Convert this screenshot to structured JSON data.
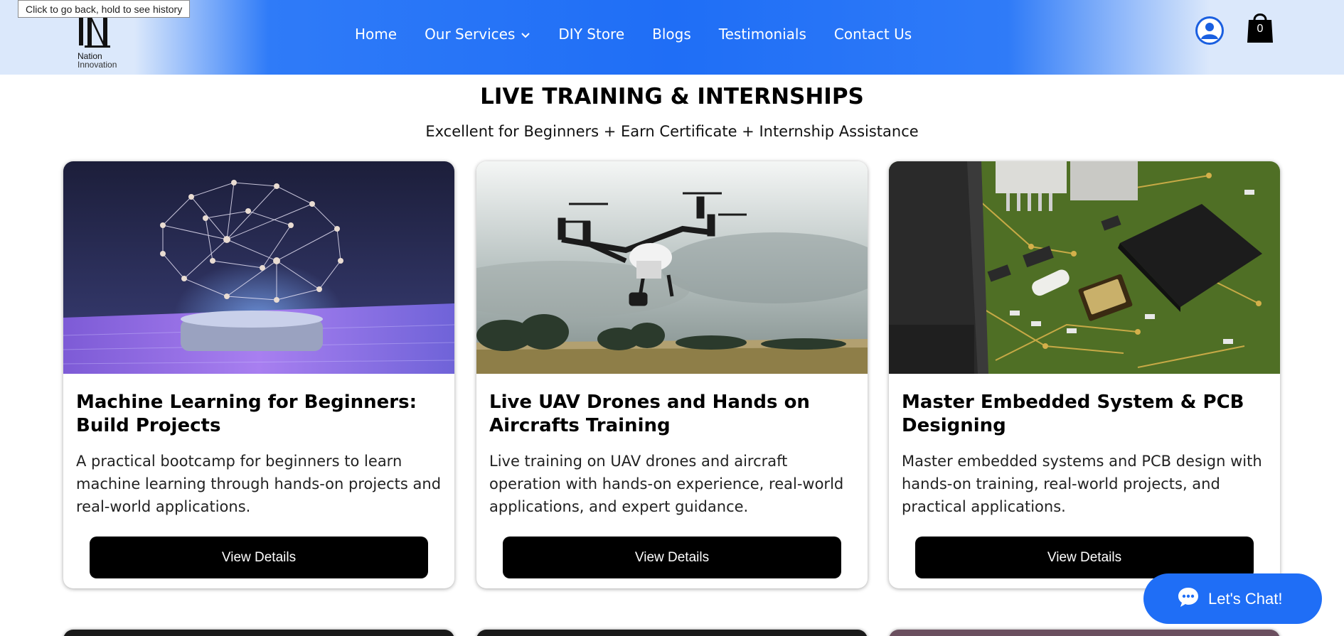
{
  "browser": {
    "back_tooltip": "Click to go back, hold to see history"
  },
  "header": {
    "logo_mark": "IN",
    "logo_line1": "Nation",
    "logo_line2": "Innovation",
    "nav": [
      {
        "label": "Home"
      },
      {
        "label": "Our Services"
      },
      {
        "label": "DIY Store"
      },
      {
        "label": "Blogs"
      },
      {
        "label": "Testimonials"
      },
      {
        "label": "Contact Us"
      }
    ],
    "cart_count": "0",
    "colors": {
      "primary": "#1f6ef6",
      "light": "#dbe8fb"
    }
  },
  "section": {
    "title": "LIVE TRAINING & INTERNSHIPS",
    "subtitle": "Excellent for Beginners + Earn Certificate + Internship Assistance"
  },
  "cards": [
    {
      "image": "ai-brain-hologram",
      "title": "Machine Learning for Beginners: Build Projects",
      "description": "A practical bootcamp for beginners to learn machine learning through hands-on projects and real-world applications.",
      "button": "View Details"
    },
    {
      "image": "drone-in-flight",
      "title": "Live UAV Drones and Hands on Aircrafts Training",
      "description": "Live training on UAV drones and aircraft operation with hands-on experience, real-world applications, and expert guidance.",
      "button": "View Details"
    },
    {
      "image": "pcb-circuit-board",
      "title": "Master Embedded System & PCB Designing",
      "description": "Master embedded systems and PCB design with hands-on training, real-world projects, and practical applications.",
      "button": "View Details"
    }
  ],
  "chat": {
    "label": "Let's Chat!"
  }
}
